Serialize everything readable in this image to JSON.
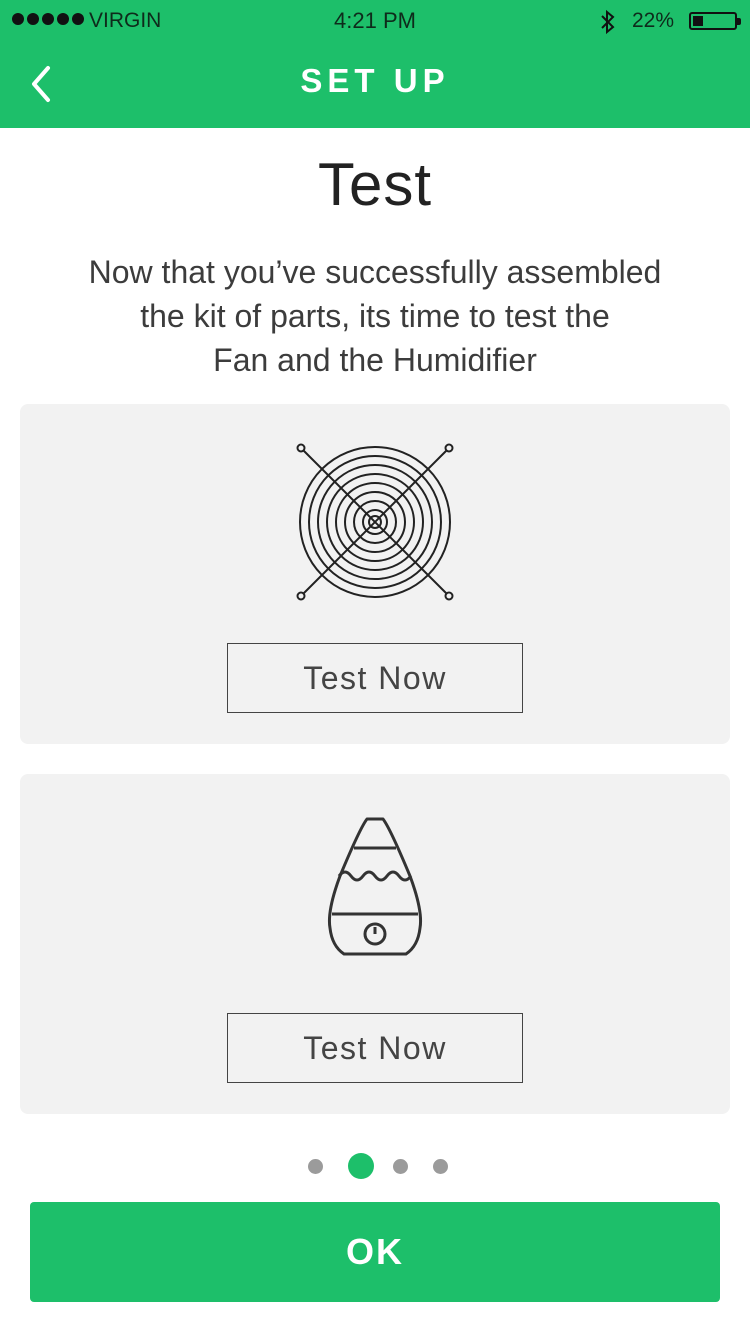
{
  "status_bar": {
    "carrier": "VIRGIN",
    "time": "4:21 PM",
    "battery_percent": "22%",
    "battery_level": 0.22,
    "bluetooth_icon": "bluetooth-icon"
  },
  "nav": {
    "back_icon": "chevron-left-icon",
    "title": "SET UP"
  },
  "page": {
    "title": "Test",
    "intro_lines": [
      "Now that you’ve successfully  assembled",
      "the kit of parts, its time to test the",
      "Fan and the Humidifier"
    ]
  },
  "cards": [
    {
      "icon": "fan-grille-icon",
      "button_label": "Test Now"
    },
    {
      "icon": "humidifier-icon",
      "button_label": "Test Now"
    }
  ],
  "pager": {
    "count": 4,
    "active_index": 1
  },
  "ok_button": {
    "label": "OK"
  },
  "colors": {
    "accent": "#1dbf6a",
    "card_bg": "#f2f2f2",
    "text": "#333333"
  }
}
